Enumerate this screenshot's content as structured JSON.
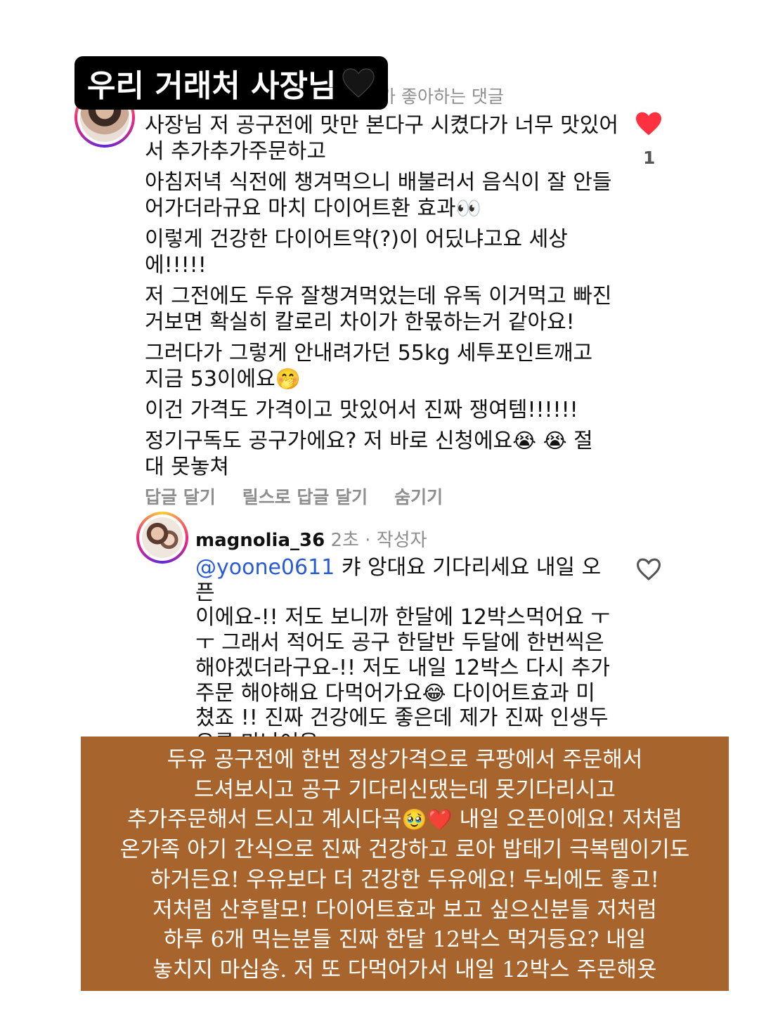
{
  "overlay_title": {
    "text": "우리 거래처 사장님",
    "emoji": "🖤"
  },
  "liked_note": "가 좋아하는 댓글",
  "main_comment": {
    "paragraphs": [
      "사장님 저 공구전에 맛만 본다구 시켰다가 너무 맛있어",
      "서 추가추가주문하고",
      "아침저녁 식전에 챙겨먹으니 배불러서 음식이 잘 안들",
      "어가더라규요 마치 다이어트환 효과",
      "이렇게 건강한 다이어트약(?)이 어딨냐고요 세상",
      "에!!!!!",
      "저 그전에도 두유 잘챙겨먹었는데 유독 이거먹고 빠진",
      "거보면 확실히 칼로리 차이가 한몫하는거 같아요!",
      "그러다가 그렇게 안내려가던 55kg 세투포인트깨고",
      "지금 53이에요",
      "이건 가격도 가격이고 맛있어서 진짜 쟁여템!!!!!!",
      "정기구독도 공구가에요? 저 바로 신청에요",
      "절",
      "대 못놓쳐"
    ],
    "emojis": {
      "eyes": "👀",
      "shush": "🤭",
      "cry": "😭"
    },
    "like_count": "1"
  },
  "actions": {
    "reply": "답글 달기",
    "reels_reply": "릴스로 답글 달기",
    "hide": "숨기기"
  },
  "reply": {
    "username": "magnolia_36",
    "meta": "2초 · 작성자",
    "mention": "@yoone0611",
    "lines": [
      "캬 앙대요 기다리세요 내일 오픈",
      "이에요-!! 저도 보니까 한달에 12박스먹어요 ㅜ",
      "ㅜ 그래서 적어도 공구 한달반 두달에 한번씩은",
      "해야겠더라구요-!! 저도 내일 12박스 다시 추가",
      "주문 해야해요 다먹어가요",
      "다이어트효과 미",
      "쳤죠 !! 진짜 건강에도 좋은데 제가 진짜 인생두",
      "유를 만났어용 ㅜㅜ"
    ],
    "emoji_laugh": "😂"
  },
  "caption": {
    "lines": [
      "두유 공구전에 한번 정상가격으로 쿠팡에서 주문해서",
      "드셔보시고 공구 기다리신댔는데 못기다리시고",
      "추가주문해서 드시고 계시다곡",
      "내일 오픈이에요! 저처럼",
      "온가족 아기 간식으로 진짜 건강하고 로아 밥태기 극복템이기도",
      "하거든요! 우유보다 더 건강한 두유에요! 두뇌에도 좋고!",
      "저처럼 산후탈모! 다이어트효과 보고 싶으신분들 저처럼",
      "하루 6개 먹는분들 진짜 한달 12박스 먹거등요? 내일",
      "놓치지 마십숑. 저 또 다먹어가서 내일 12박스 주문해욧"
    ],
    "emojis": {
      "pleading": "🥹",
      "heart": "❤️"
    },
    "background_color": "#a8642d"
  },
  "colors": {
    "like_red": "#ff3040",
    "mention_blue": "#2a5bd7",
    "muted": "#8e8e8e"
  }
}
